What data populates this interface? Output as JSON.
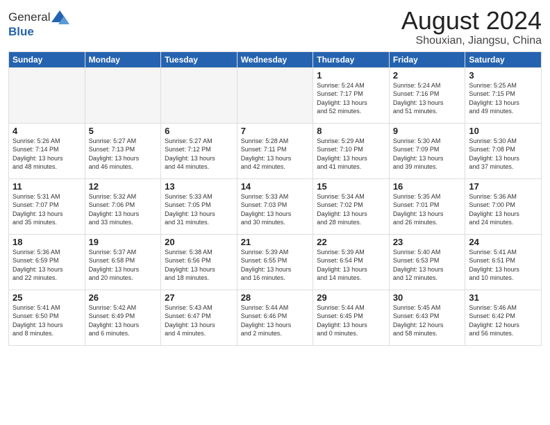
{
  "header": {
    "logo_general": "General",
    "logo_blue": "Blue",
    "month_year": "August 2024",
    "location": "Shouxian, Jiangsu, China"
  },
  "weekdays": [
    "Sunday",
    "Monday",
    "Tuesday",
    "Wednesday",
    "Thursday",
    "Friday",
    "Saturday"
  ],
  "weeks": [
    [
      {
        "day": "",
        "info": ""
      },
      {
        "day": "",
        "info": ""
      },
      {
        "day": "",
        "info": ""
      },
      {
        "day": "",
        "info": ""
      },
      {
        "day": "1",
        "info": "Sunrise: 5:24 AM\nSunset: 7:17 PM\nDaylight: 13 hours\nand 52 minutes."
      },
      {
        "day": "2",
        "info": "Sunrise: 5:24 AM\nSunset: 7:16 PM\nDaylight: 13 hours\nand 51 minutes."
      },
      {
        "day": "3",
        "info": "Sunrise: 5:25 AM\nSunset: 7:15 PM\nDaylight: 13 hours\nand 49 minutes."
      }
    ],
    [
      {
        "day": "4",
        "info": "Sunrise: 5:26 AM\nSunset: 7:14 PM\nDaylight: 13 hours\nand 48 minutes."
      },
      {
        "day": "5",
        "info": "Sunrise: 5:27 AM\nSunset: 7:13 PM\nDaylight: 13 hours\nand 46 minutes."
      },
      {
        "day": "6",
        "info": "Sunrise: 5:27 AM\nSunset: 7:12 PM\nDaylight: 13 hours\nand 44 minutes."
      },
      {
        "day": "7",
        "info": "Sunrise: 5:28 AM\nSunset: 7:11 PM\nDaylight: 13 hours\nand 42 minutes."
      },
      {
        "day": "8",
        "info": "Sunrise: 5:29 AM\nSunset: 7:10 PM\nDaylight: 13 hours\nand 41 minutes."
      },
      {
        "day": "9",
        "info": "Sunrise: 5:30 AM\nSunset: 7:09 PM\nDaylight: 13 hours\nand 39 minutes."
      },
      {
        "day": "10",
        "info": "Sunrise: 5:30 AM\nSunset: 7:08 PM\nDaylight: 13 hours\nand 37 minutes."
      }
    ],
    [
      {
        "day": "11",
        "info": "Sunrise: 5:31 AM\nSunset: 7:07 PM\nDaylight: 13 hours\nand 35 minutes."
      },
      {
        "day": "12",
        "info": "Sunrise: 5:32 AM\nSunset: 7:06 PM\nDaylight: 13 hours\nand 33 minutes."
      },
      {
        "day": "13",
        "info": "Sunrise: 5:33 AM\nSunset: 7:05 PM\nDaylight: 13 hours\nand 31 minutes."
      },
      {
        "day": "14",
        "info": "Sunrise: 5:33 AM\nSunset: 7:03 PM\nDaylight: 13 hours\nand 30 minutes."
      },
      {
        "day": "15",
        "info": "Sunrise: 5:34 AM\nSunset: 7:02 PM\nDaylight: 13 hours\nand 28 minutes."
      },
      {
        "day": "16",
        "info": "Sunrise: 5:35 AM\nSunset: 7:01 PM\nDaylight: 13 hours\nand 26 minutes."
      },
      {
        "day": "17",
        "info": "Sunrise: 5:36 AM\nSunset: 7:00 PM\nDaylight: 13 hours\nand 24 minutes."
      }
    ],
    [
      {
        "day": "18",
        "info": "Sunrise: 5:36 AM\nSunset: 6:59 PM\nDaylight: 13 hours\nand 22 minutes."
      },
      {
        "day": "19",
        "info": "Sunrise: 5:37 AM\nSunset: 6:58 PM\nDaylight: 13 hours\nand 20 minutes."
      },
      {
        "day": "20",
        "info": "Sunrise: 5:38 AM\nSunset: 6:56 PM\nDaylight: 13 hours\nand 18 minutes."
      },
      {
        "day": "21",
        "info": "Sunrise: 5:39 AM\nSunset: 6:55 PM\nDaylight: 13 hours\nand 16 minutes."
      },
      {
        "day": "22",
        "info": "Sunrise: 5:39 AM\nSunset: 6:54 PM\nDaylight: 13 hours\nand 14 minutes."
      },
      {
        "day": "23",
        "info": "Sunrise: 5:40 AM\nSunset: 6:53 PM\nDaylight: 13 hours\nand 12 minutes."
      },
      {
        "day": "24",
        "info": "Sunrise: 5:41 AM\nSunset: 6:51 PM\nDaylight: 13 hours\nand 10 minutes."
      }
    ],
    [
      {
        "day": "25",
        "info": "Sunrise: 5:41 AM\nSunset: 6:50 PM\nDaylight: 13 hours\nand 8 minutes."
      },
      {
        "day": "26",
        "info": "Sunrise: 5:42 AM\nSunset: 6:49 PM\nDaylight: 13 hours\nand 6 minutes."
      },
      {
        "day": "27",
        "info": "Sunrise: 5:43 AM\nSunset: 6:47 PM\nDaylight: 13 hours\nand 4 minutes."
      },
      {
        "day": "28",
        "info": "Sunrise: 5:44 AM\nSunset: 6:46 PM\nDaylight: 13 hours\nand 2 minutes."
      },
      {
        "day": "29",
        "info": "Sunrise: 5:44 AM\nSunset: 6:45 PM\nDaylight: 13 hours\nand 0 minutes."
      },
      {
        "day": "30",
        "info": "Sunrise: 5:45 AM\nSunset: 6:43 PM\nDaylight: 12 hours\nand 58 minutes."
      },
      {
        "day": "31",
        "info": "Sunrise: 5:46 AM\nSunset: 6:42 PM\nDaylight: 12 hours\nand 56 minutes."
      }
    ]
  ]
}
